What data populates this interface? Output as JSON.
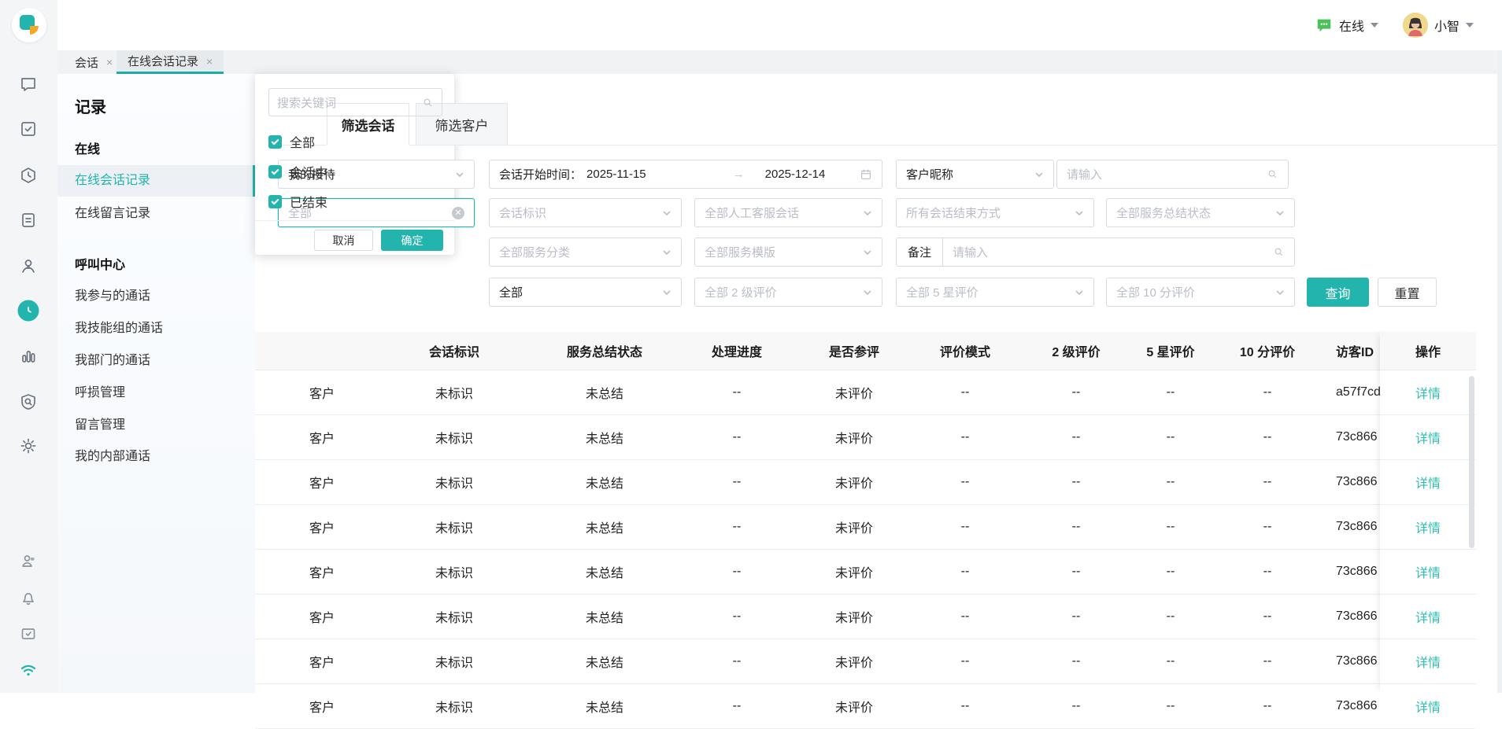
{
  "colors": {
    "accent": "#23b4ad",
    "link": "#2fbdb3",
    "status_green": "#4cc15a",
    "tab_underline": "#1aada6"
  },
  "topbar": {
    "status_label": "在线",
    "user_name": "小智"
  },
  "workspace_tabs": [
    {
      "label": "会话",
      "close": "×"
    },
    {
      "label": "在线会话记录",
      "close": "×",
      "active": true
    }
  ],
  "rail_icons": [
    "chat-icon",
    "task-check-icon",
    "shield-clock-icon",
    "document-icon",
    "person-icon",
    "clock-icon-active",
    "bar-chart-icon",
    "shield-search-icon",
    "gear-icon",
    "person-badge-icon",
    "bell-icon",
    "folder-check-icon",
    "wifi-icon"
  ],
  "sidebar": {
    "title": "记录",
    "sections": [
      {
        "heading": "在线",
        "items": [
          {
            "label": "在线会话记录",
            "active": true
          },
          {
            "label": "在线留言记录",
            "active": false
          }
        ]
      },
      {
        "heading": "呼叫中心",
        "items": [
          {
            "label": "我参与的通话"
          },
          {
            "label": "我技能组的通话"
          },
          {
            "label": "我部门的通话"
          },
          {
            "label": "呼损管理"
          },
          {
            "label": "留言管理"
          },
          {
            "label": "我的内部通话"
          }
        ]
      }
    ]
  },
  "filter_tabs": [
    {
      "label": "筛选会话",
      "active": true
    },
    {
      "label": "筛选客户",
      "active": false
    }
  ],
  "filters": {
    "reception_value": "我的接待",
    "date_label": "会话开始时间：",
    "date_start": "2025-11-15",
    "date_end": "2025-12-14",
    "nickname_value": "客户昵称",
    "nickname_placeholder": "请输入",
    "status_value": "全部",
    "session_tag_placeholder": "会话标识",
    "agent_session_placeholder": "全部人工客服会话",
    "end_mode_placeholder": "所有会话结束方式",
    "summary_status_placeholder": "全部服务总结状态",
    "service_category_placeholder": "全部服务分类",
    "service_template_placeholder": "全部服务模版",
    "remark_label": "备注",
    "remark_placeholder": "请输入",
    "all_value": "全部",
    "eval2_placeholder": "全部 2 级评价",
    "eval5_placeholder": "全部 5 星评价",
    "eval10_placeholder": "全部 10 分评价",
    "search_button": "查询",
    "reset_button": "重置"
  },
  "status_dropdown": {
    "search_placeholder": "搜索关键词",
    "options": [
      {
        "label": "全部",
        "checked": true
      },
      {
        "label": "会话中",
        "checked": true
      },
      {
        "label": "已结束",
        "checked": true
      }
    ],
    "cancel_button": "取消",
    "confirm_button": "确定"
  },
  "table": {
    "headers": [
      "",
      "会话标识",
      "服务总结状态",
      "处理进度",
      "是否参评",
      "评价模式",
      "2 级评价",
      "5 星评价",
      "10 分评价",
      "访客ID",
      "操作"
    ],
    "action_label": "详情",
    "rows": [
      {
        "type": "客户",
        "tag": "未标识",
        "summary": "未总结",
        "progress": "--",
        "participated": "未评价",
        "mode": "--",
        "eval2": "--",
        "eval5": "--",
        "eval10": "--",
        "visitor_id": "a57f7cd"
      },
      {
        "type": "客户",
        "tag": "未标识",
        "summary": "未总结",
        "progress": "--",
        "participated": "未评价",
        "mode": "--",
        "eval2": "--",
        "eval5": "--",
        "eval10": "--",
        "visitor_id": "73c866"
      },
      {
        "type": "客户",
        "tag": "未标识",
        "summary": "未总结",
        "progress": "--",
        "participated": "未评价",
        "mode": "--",
        "eval2": "--",
        "eval5": "--",
        "eval10": "--",
        "visitor_id": "73c866"
      },
      {
        "type": "客户",
        "tag": "未标识",
        "summary": "未总结",
        "progress": "--",
        "participated": "未评价",
        "mode": "--",
        "eval2": "--",
        "eval5": "--",
        "eval10": "--",
        "visitor_id": "73c866"
      },
      {
        "type": "客户",
        "tag": "未标识",
        "summary": "未总结",
        "progress": "--",
        "participated": "未评价",
        "mode": "--",
        "eval2": "--",
        "eval5": "--",
        "eval10": "--",
        "visitor_id": "73c866"
      },
      {
        "type": "客户",
        "tag": "未标识",
        "summary": "未总结",
        "progress": "--",
        "participated": "未评价",
        "mode": "--",
        "eval2": "--",
        "eval5": "--",
        "eval10": "--",
        "visitor_id": "73c866"
      },
      {
        "type": "客户",
        "tag": "未标识",
        "summary": "未总结",
        "progress": "--",
        "participated": "未评价",
        "mode": "--",
        "eval2": "--",
        "eval5": "--",
        "eval10": "--",
        "visitor_id": "73c866"
      },
      {
        "type": "客户",
        "tag": "未标识",
        "summary": "未总结",
        "progress": "--",
        "participated": "未评价",
        "mode": "--",
        "eval2": "--",
        "eval5": "--",
        "eval10": "--",
        "visitor_id": "73c866"
      }
    ]
  }
}
